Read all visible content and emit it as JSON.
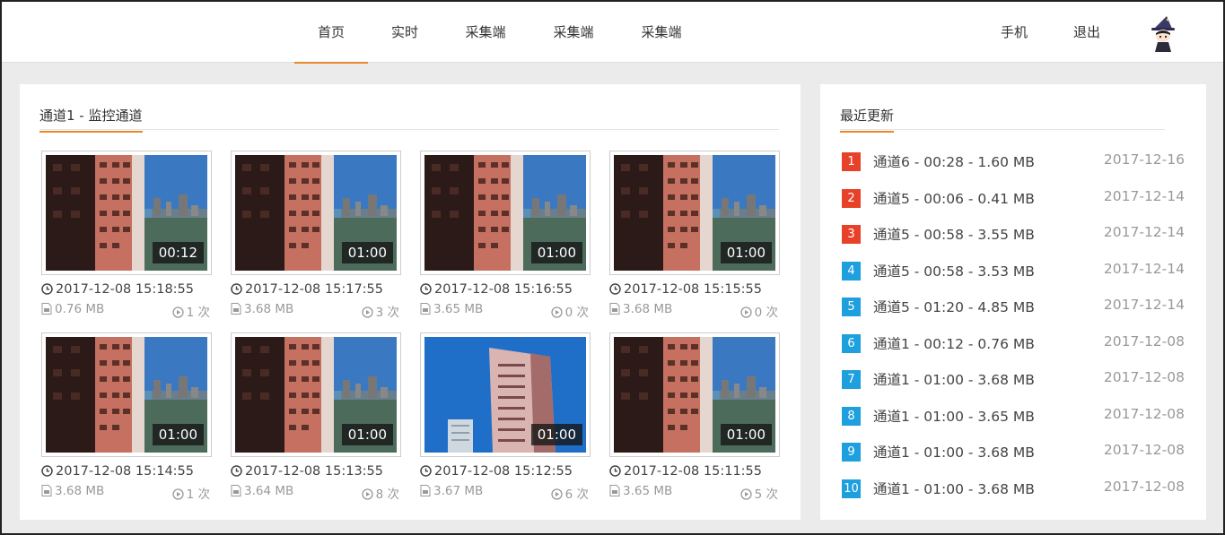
{
  "nav": {
    "items": [
      {
        "label": "首页",
        "active": true
      },
      {
        "label": "实时",
        "active": false
      },
      {
        "label": "采集端",
        "active": false
      },
      {
        "label": "采集端",
        "active": false
      },
      {
        "label": "采集端",
        "active": false
      }
    ],
    "phone_label": "手机",
    "logout_label": "退出",
    "avatar_icon": "wizard-avatar-icon"
  },
  "channel": {
    "title": "通道1 - 监控通道",
    "videos": [
      {
        "duration": "00:12",
        "time": "2017-12-08 15:18:55",
        "size": "0.76 MB",
        "views": "1 次",
        "scene": "building"
      },
      {
        "duration": "01:00",
        "time": "2017-12-08 15:17:55",
        "size": "3.68 MB",
        "views": "3 次",
        "scene": "building"
      },
      {
        "duration": "01:00",
        "time": "2017-12-08 15:16:55",
        "size": "3.65 MB",
        "views": "0 次",
        "scene": "building"
      },
      {
        "duration": "01:00",
        "time": "2017-12-08 15:15:55",
        "size": "3.68 MB",
        "views": "0 次",
        "scene": "building"
      },
      {
        "duration": "01:00",
        "time": "2017-12-08 15:14:55",
        "size": "3.68 MB",
        "views": "1 次",
        "scene": "building"
      },
      {
        "duration": "01:00",
        "time": "2017-12-08 15:13:55",
        "size": "3.64 MB",
        "views": "8 次",
        "scene": "building"
      },
      {
        "duration": "01:00",
        "time": "2017-12-08 15:12:55",
        "size": "3.67 MB",
        "views": "6 次",
        "scene": "skyline"
      },
      {
        "duration": "01:00",
        "time": "2017-12-08 15:11:55",
        "size": "3.65 MB",
        "views": "5 次",
        "scene": "building"
      }
    ]
  },
  "recent": {
    "title": "最近更新",
    "items": [
      {
        "rank": "1",
        "label": "通道6 - 00:28 - 1.60 MB",
        "date": "2017-12-16",
        "color": "#e8412a"
      },
      {
        "rank": "2",
        "label": "通道5 - 00:06 - 0.41 MB",
        "date": "2017-12-14",
        "color": "#e8412a"
      },
      {
        "rank": "3",
        "label": "通道5 - 00:58 - 3.55 MB",
        "date": "2017-12-14",
        "color": "#e8412a"
      },
      {
        "rank": "4",
        "label": "通道5 - 00:58 - 3.53 MB",
        "date": "2017-12-14",
        "color": "#1e9fde"
      },
      {
        "rank": "5",
        "label": "通道5 - 01:20 - 4.85 MB",
        "date": "2017-12-14",
        "color": "#1e9fde"
      },
      {
        "rank": "6",
        "label": "通道1 - 00:12 - 0.76 MB",
        "date": "2017-12-08",
        "color": "#1e9fde"
      },
      {
        "rank": "7",
        "label": "通道1 - 01:00 - 3.68 MB",
        "date": "2017-12-08",
        "color": "#1e9fde"
      },
      {
        "rank": "8",
        "label": "通道1 - 01:00 - 3.65 MB",
        "date": "2017-12-08",
        "color": "#1e9fde"
      },
      {
        "rank": "9",
        "label": "通道1 - 01:00 - 3.68 MB",
        "date": "2017-12-08",
        "color": "#1e9fde"
      },
      {
        "rank": "10",
        "label": "通道1 - 01:00 - 3.68 MB",
        "date": "2017-12-08",
        "color": "#1e9fde"
      }
    ]
  },
  "colors": {
    "accent": "#e8872b"
  }
}
